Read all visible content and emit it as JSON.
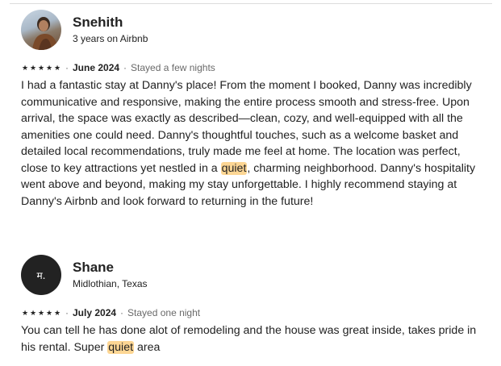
{
  "reviews": [
    {
      "name": "Snehith",
      "subtitle": "3 years on Airbnb",
      "stars": [
        "★",
        "★",
        "★",
        "★",
        "★"
      ],
      "rating": 5,
      "date": "June 2024",
      "stay": "Stayed a few nights",
      "text_before": "I had a fantastic stay at Danny's place! From the moment I booked, Danny was incredibly communicative and responsive, making the entire process smooth and stress-free. Upon arrival, the space was exactly as described—clean, cozy, and well-equipped with all the amenities one could need. Danny's thoughtful touches, such as a welcome basket and detailed local recommendations, truly made me feel at home. The location was perfect, close to key attractions yet nestled in a ",
      "highlight": "quiet",
      "text_after": ", charming neighborhood. Danny's hospitality went above and beyond, making my stay unforgettable. I highly recommend staying at Danny's Airbnb and look forward to returning in the future!"
    },
    {
      "name": "Shane",
      "subtitle": "Midlothian, Texas",
      "avatar_initial": "म.",
      "stars": [
        "★",
        "★",
        "★",
        "★",
        "★"
      ],
      "rating": 5,
      "date": "July 2024",
      "stay": "Stayed one night",
      "text_before": "You can tell he has done alot of remodeling and the house was great inside, takes pride in his rental.  Super ",
      "highlight": "quiet",
      "text_after": " area"
    }
  ],
  "meta_separator": "·",
  "colors": {
    "highlight": "#fdd694",
    "text": "#222222",
    "muted": "#6a6a6a"
  }
}
